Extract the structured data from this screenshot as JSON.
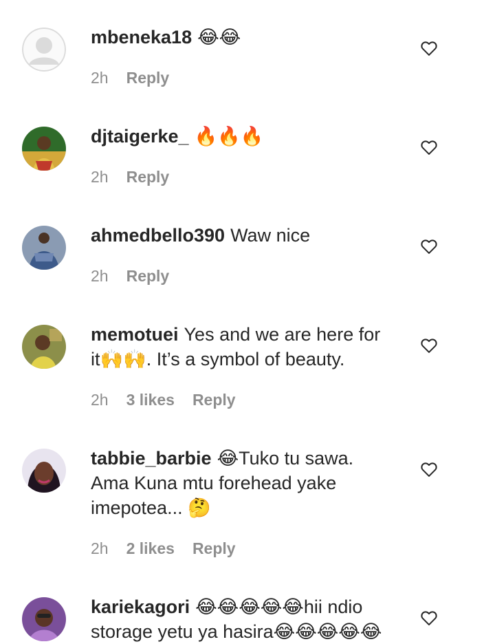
{
  "comments": [
    {
      "username": "mbeneka18",
      "text": "😂😂",
      "time": "2h",
      "likes": "",
      "reply": "Reply"
    },
    {
      "username": "djtaigerke_",
      "text": "🔥🔥🔥",
      "time": "2h",
      "likes": "",
      "reply": "Reply"
    },
    {
      "username": "ahmedbello390",
      "text": "Waw nice",
      "time": "2h",
      "likes": "",
      "reply": "Reply"
    },
    {
      "username": "memotuei",
      "text": "Yes and we are here for it🙌🙌. It’s a symbol of beauty.",
      "time": "2h",
      "likes": "3 likes",
      "reply": "Reply"
    },
    {
      "username": "tabbie_barbie",
      "text": "😂Tuko tu sawa. Ama Kuna mtu forehead yake imepotea... 🤔",
      "time": "2h",
      "likes": "2 likes",
      "reply": "Reply"
    },
    {
      "username": "kariekagori",
      "text": "😂😂😂😂😂hii ndio storage yetu ya hasira😂😂😂😂😂",
      "time": "",
      "likes": "",
      "reply": ""
    }
  ],
  "icons": {
    "like": "heart-outline-icon",
    "avatar_placeholder": "person-placeholder-icon"
  },
  "colors": {
    "username": "#262626",
    "meta": "#8e8e8e",
    "placeholder_avatar": "#dbdbdb"
  }
}
